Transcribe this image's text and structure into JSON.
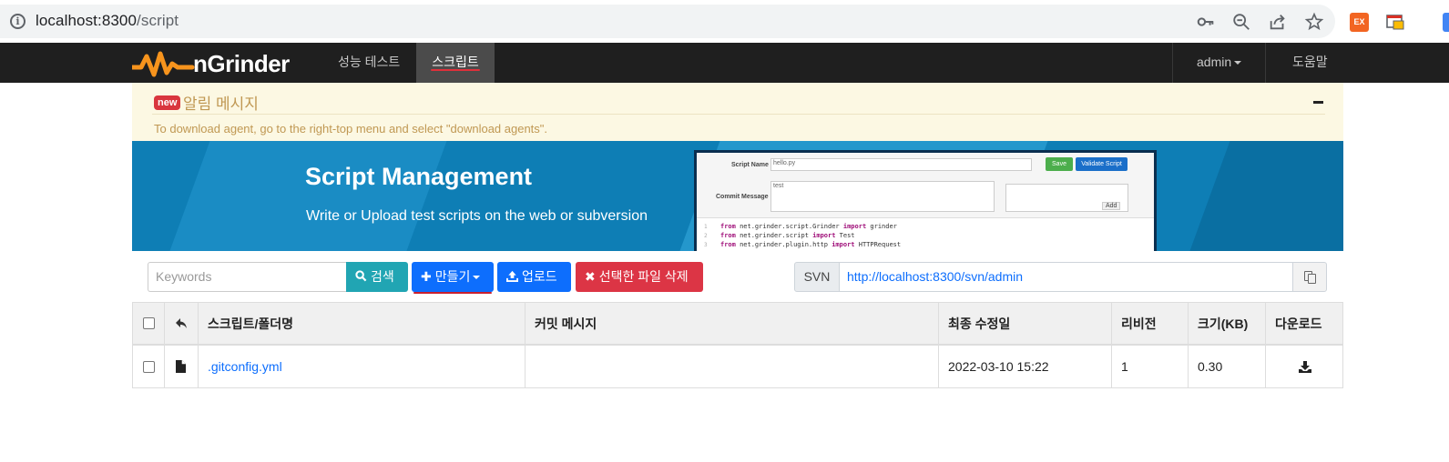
{
  "browser": {
    "url_host": "localhost:8300",
    "url_path": "/script",
    "extension_ex": "EX"
  },
  "navbar": {
    "brand": "nGrinder",
    "items": [
      {
        "label": "성능 테스트",
        "active": false
      },
      {
        "label": "스크립트",
        "active": true
      }
    ],
    "user": "admin",
    "help": "도움말"
  },
  "alert": {
    "badge": "new",
    "title": "알림 메시지",
    "message": "To download agent, go to the right-top menu and select \"download agents\"."
  },
  "banner": {
    "title": "Script Management",
    "subtitle": "Write or Upload test scripts on the web or subversion",
    "preview": {
      "script_name_label": "Script Name",
      "script_name_value": "hello.py",
      "commit_label": "Commit Message",
      "commit_value": "test",
      "save_label": "Save",
      "validate_label": "Validate Script",
      "add_label": "Add",
      "code_lines": [
        {
          "num": "1",
          "kw": "from",
          "mod": " net.grinder.script.Grinder ",
          "kw2": "import",
          "rest": " grinder"
        },
        {
          "num": "2",
          "kw": "from",
          "mod": " net.grinder.script ",
          "kw2": "import",
          "rest": " Test"
        },
        {
          "num": "3",
          "kw": "from",
          "mod": " net.grinder.plugin.http ",
          "kw2": "import",
          "rest": " HTTPRequest"
        }
      ]
    }
  },
  "toolbar": {
    "search_placeholder": "Keywords",
    "search_label": "검색",
    "create_label": "만들기",
    "upload_label": "업로드",
    "delete_label": "선택한 파일 삭제",
    "svn_label": "SVN",
    "svn_url": "http://localhost:8300/svn/admin"
  },
  "table": {
    "headers": {
      "name": "스크립트/폴더명",
      "commit": "커밋 메시지",
      "modified": "최종 수정일",
      "revision": "리비전",
      "size": "크기(KB)",
      "download": "다운로드"
    },
    "rows": [
      {
        "name": ".gitconfig.yml",
        "commit": "",
        "modified": "2022-03-10 15:22",
        "revision": "1",
        "size": "0.30"
      }
    ]
  },
  "colors": {
    "navbar_bg": "#1f1f1f",
    "alert_bg": "#fcf8e3",
    "banner_bg": "#0e7eb5",
    "primary": "#0d6efd",
    "info": "#21a5b3",
    "danger": "#dc3545",
    "logo_orange": "#f7941d"
  }
}
